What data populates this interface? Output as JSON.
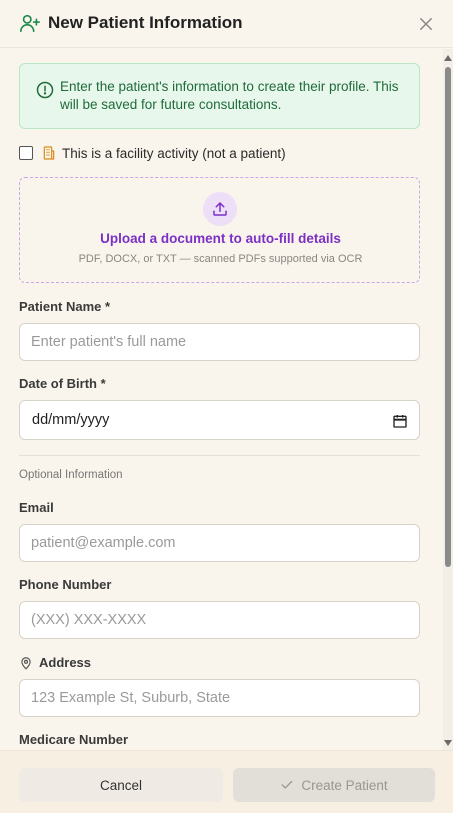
{
  "dialog": {
    "title": "New Patient Information",
    "info_message": "Enter the patient's information to create their profile. This will be saved for future consultations.",
    "facility_checkbox_label": "This is a facility activity (not a patient)",
    "facility_checked": false
  },
  "upload": {
    "title": "Upload a document to auto-fill details",
    "subtitle": "PDF, DOCX, or TXT — scanned PDFs supported via OCR"
  },
  "form": {
    "patient_name": {
      "label": "Patient Name *",
      "placeholder": "Enter patient's full name",
      "value": ""
    },
    "dob": {
      "label": "Date of Birth *",
      "value": "dd/mm/yyyy"
    },
    "optional_section": "Optional Information",
    "email": {
      "label": "Email",
      "placeholder": "patient@example.com",
      "value": ""
    },
    "phone": {
      "label": "Phone Number",
      "placeholder": "(XXX) XXX-XXXX",
      "value": ""
    },
    "address": {
      "label": "Address",
      "placeholder": "123 Example St, Suburb, State",
      "value": ""
    },
    "medicare": {
      "label": "Medicare Number"
    }
  },
  "footer": {
    "cancel_label": "Cancel",
    "create_label": "Create Patient"
  },
  "icons": {
    "header": "user-plus-icon",
    "close": "close-icon",
    "info": "info-circle-icon",
    "facility": "building-icon",
    "upload": "upload-icon",
    "calendar": "calendar-icon",
    "address": "map-pin-icon",
    "create": "check-icon"
  },
  "colors": {
    "background": "#faf5ec",
    "info_bg": "#e8f7ec",
    "info_text": "#1f6b3a",
    "accent_purple": "#7b2fc5",
    "primary_green": "#1f8a4c"
  }
}
